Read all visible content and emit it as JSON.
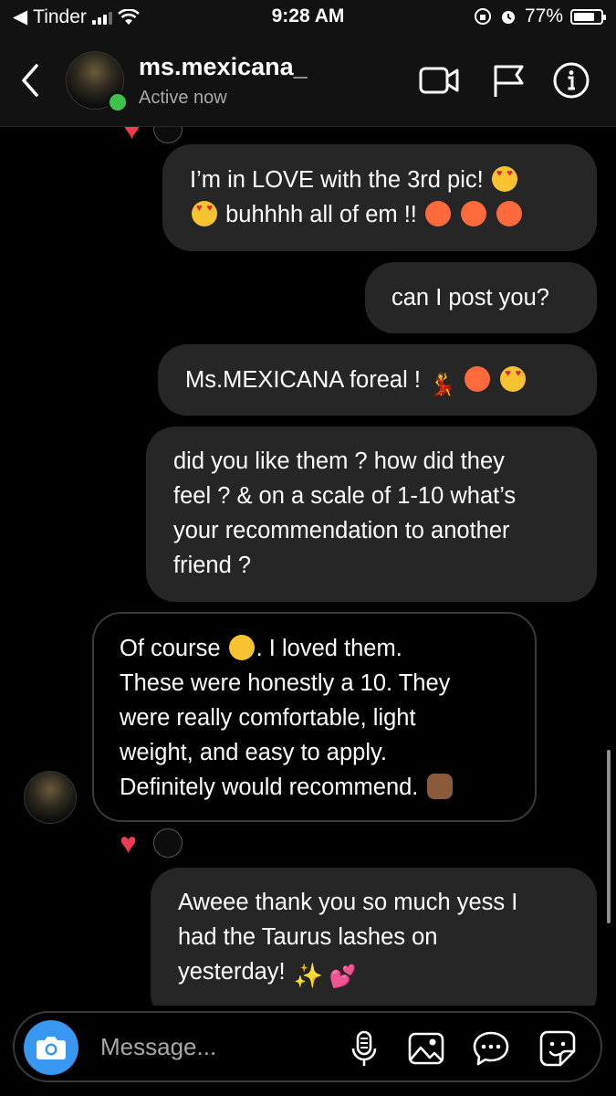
{
  "status_bar": {
    "back_app": "Tinder",
    "time": "9:28 AM",
    "battery": "77%",
    "battery_level": 0.77
  },
  "header": {
    "username": "ms.mexicana_",
    "status": "Active now"
  },
  "messages": {
    "m1_l1": "I’m in LOVE with the 3rd pic!",
    "m1_l2": "buhhhh all of em !!",
    "m2": "can I post you?",
    "m3": "Ms.MEXICANA foreal !",
    "m4_l1": "did you like them ? how did they",
    "m4_l2": "feel ? & on a scale of 1-10 what’s",
    "m4_l3": "your recommendation to another",
    "m4_l4": "friend ?",
    "m5_l1a": "Of course",
    "m5_l1b": ". I loved them.",
    "m5_l2": "These were honestly a 10. They",
    "m5_l3": "were really comfortable, light",
    "m5_l4": "weight, and easy to apply.",
    "m5_l5": "Definitely would recommend.",
    "m6_l1": "Aweee thank you so much yess I",
    "m6_l2": "had the Taurus lashes on",
    "m6_l3": "yesterday!"
  },
  "composer": {
    "placeholder": "Message..."
  },
  "colors": {
    "outgoing_bubble": "#262626",
    "online": "#3ec34a",
    "camera": "#3897f0",
    "reaction_heart": "#ef3b4f"
  }
}
